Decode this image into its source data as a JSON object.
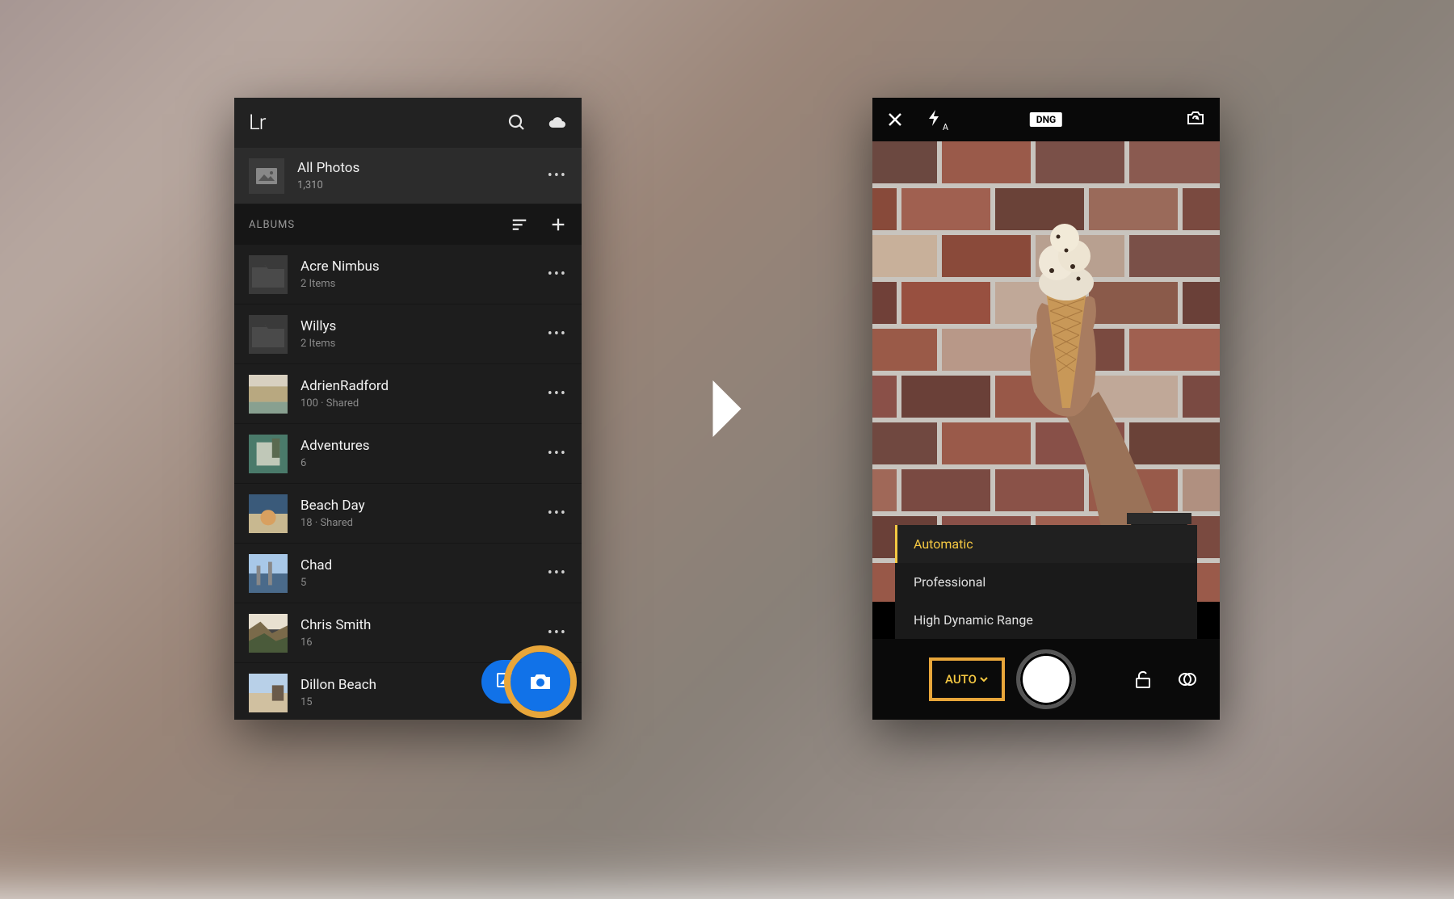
{
  "left": {
    "logo": "Lr",
    "allPhotos": {
      "title": "All Photos",
      "count": "1,310"
    },
    "albumsHeader": "ALBUMS",
    "albums": [
      {
        "name": "Acre Nimbus",
        "sub": "2 Items",
        "type": "folder"
      },
      {
        "name": "Willys",
        "sub": "2 Items",
        "type": "folder"
      },
      {
        "name": "AdrienRadford",
        "sub": "100 · Shared",
        "type": "photo"
      },
      {
        "name": "Adventures",
        "sub": "6",
        "type": "photo"
      },
      {
        "name": "Beach Day",
        "sub": "18 · Shared",
        "type": "photo"
      },
      {
        "name": "Chad",
        "sub": "5",
        "type": "photo"
      },
      {
        "name": "Chris Smith",
        "sub": "16",
        "type": "photo"
      },
      {
        "name": "Dillon Beach",
        "sub": "15",
        "type": "photo"
      }
    ]
  },
  "right": {
    "format": "DNG",
    "flashMode": "A",
    "modes": [
      {
        "label": "Automatic",
        "active": true
      },
      {
        "label": "Professional",
        "active": false
      },
      {
        "label": "High Dynamic Range",
        "active": false
      }
    ],
    "autoButton": "AUTO"
  },
  "colors": {
    "accentBlue": "#1172e8",
    "highlightOrange": "#e8a63a",
    "accentYellow": "#f5c842"
  }
}
